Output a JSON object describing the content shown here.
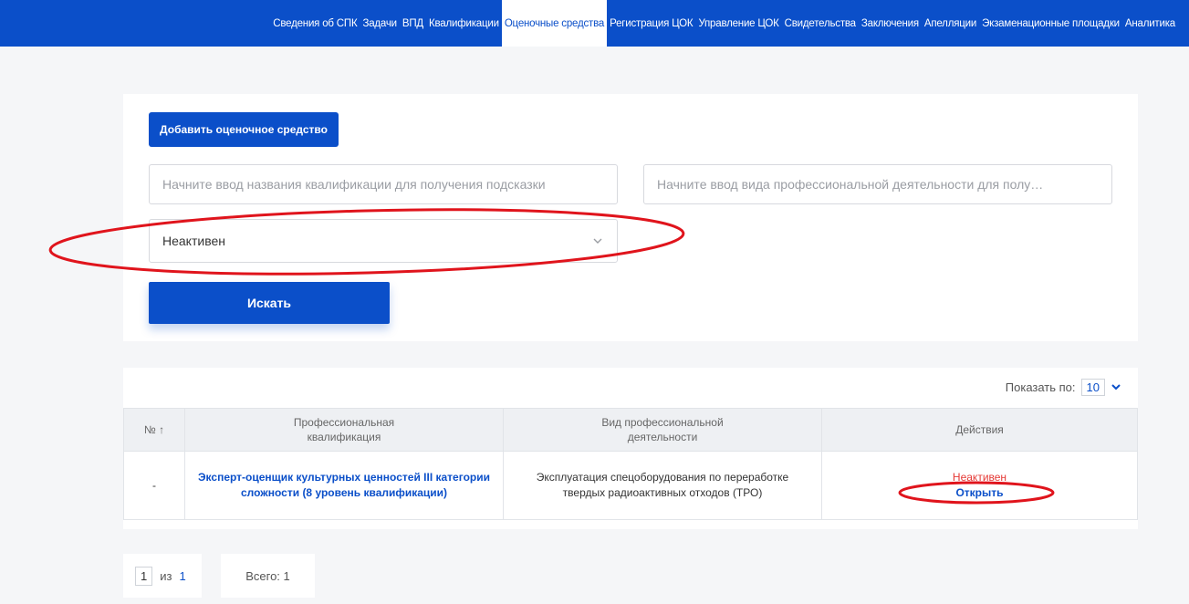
{
  "nav": {
    "items": [
      "Сведения об СПК",
      "Задачи",
      "ВПД",
      "Квалификации",
      "Оценочные средства",
      "Регистрация ЦОК",
      "Управление ЦОК",
      "Свидетельства",
      "Заключения",
      "Апелляции",
      "Экзаменационные площадки",
      "Аналитика"
    ],
    "active_index": 4
  },
  "filter": {
    "add_button": "Добавить оценочное средство",
    "qualification_placeholder": "Начните ввод названия квалификации для получения подсказки",
    "vpd_placeholder": "Начните ввод вида профессиональной деятельности для полу…",
    "status_value": "Неактивен",
    "search_button": "Искать"
  },
  "table": {
    "page_size_label": "Показать по:",
    "page_size_value": "10",
    "headers": {
      "num": "№ ↑",
      "qualification_line1": "Профессиональная",
      "qualification_line2": "квалификация",
      "vpd_line1": "Вид профессиональной",
      "vpd_line2": "деятельности",
      "actions": "Действия"
    },
    "rows": [
      {
        "num": "-",
        "qualification_line1": "Эксперт-оценщик культурных ценностей III категории",
        "qualification_line2": "сложности (8 уровень квалификации)",
        "vpd_line1": "Эксплуатация спецоборудования по переработке",
        "vpd_line2": "твердых радиоактивных отходов (ТРО)",
        "status": "Неактивен",
        "action": "Открыть"
      }
    ]
  },
  "pagination": {
    "current": "1",
    "of": "из",
    "total_pages": "1",
    "total_label": "Всего: 1"
  },
  "colors": {
    "primary": "#0b4fc9",
    "annotation": "#e0141c",
    "status_inactive": "#e53935"
  },
  "icons": {
    "select_chevron": "chevron-down-icon",
    "page_size_chevron": "chevron-down-icon"
  }
}
